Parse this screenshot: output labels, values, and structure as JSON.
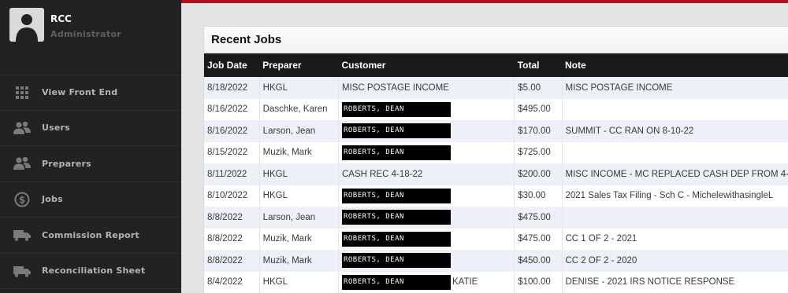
{
  "profile": {
    "name": "RCC",
    "role": "Administrator"
  },
  "sidebar": {
    "items": [
      {
        "label": "View Front End",
        "icon": "grid-icon"
      },
      {
        "label": "Users",
        "icon": "users-icon"
      },
      {
        "label": "Preparers",
        "icon": "users-icon"
      },
      {
        "label": "Jobs",
        "icon": "dollar-icon"
      },
      {
        "label": "Commission Report",
        "icon": "truck-icon"
      },
      {
        "label": "Reconciliation Sheet",
        "icon": "truck-icon"
      }
    ]
  },
  "colors": {
    "sidebar": "#222222",
    "accent": "#a8141e",
    "row_alt": "#eef0f8",
    "header": "#1a1a1a"
  },
  "panel": {
    "title": "Recent Jobs",
    "columns": [
      "Job Date",
      "Preparer",
      "Customer",
      "Total",
      "Note"
    ],
    "rows": [
      {
        "date": "8/18/2022",
        "preparer": "HKGL",
        "customer": "MISC POSTAGE INCOME",
        "redacted": false,
        "customer_suffix": "",
        "total": "$5.00",
        "note": "MISC POSTAGE INCOME"
      },
      {
        "date": "8/16/2022",
        "preparer": "Daschke, Karen",
        "customer": "ROBERTS, DEAN",
        "redacted": true,
        "customer_suffix": "",
        "total": "$495.00",
        "note": ""
      },
      {
        "date": "8/16/2022",
        "preparer": "Larson, Jean",
        "customer": "ROBERTS, DEAN",
        "redacted": true,
        "customer_suffix": "",
        "total": "$170.00",
        "note": "SUMMIT - CC RAN ON 8-10-22"
      },
      {
        "date": "8/15/2022",
        "preparer": "Muzik, Mark",
        "customer": "ROBERTS, DEAN",
        "redacted": true,
        "customer_suffix": "",
        "total": "$725.00",
        "note": ""
      },
      {
        "date": "8/11/2022",
        "preparer": "HKGL",
        "customer": "CASH REC 4-18-22",
        "redacted": false,
        "customer_suffix": "",
        "total": "$200.00",
        "note": "MISC INCOME - MC REPLACED CASH DEP FROM 4-"
      },
      {
        "date": "8/10/2022",
        "preparer": "HKGL",
        "customer": "ROBERTS, DEAN",
        "redacted": true,
        "customer_suffix": "",
        "total": "$30.00",
        "note": "2021 Sales Tax Filing - Sch C - MichelewithasingleL"
      },
      {
        "date": "8/8/2022",
        "preparer": "Larson, Jean",
        "customer": "ROBERTS, DEAN",
        "redacted": true,
        "customer_suffix": "",
        "total": "$475.00",
        "note": ""
      },
      {
        "date": "8/8/2022",
        "preparer": "Muzik, Mark",
        "customer": "ROBERTS, DEAN",
        "redacted": true,
        "customer_suffix": "",
        "total": "$475.00",
        "note": "CC 1 OF 2 - 2021"
      },
      {
        "date": "8/8/2022",
        "preparer": "Muzik, Mark",
        "customer": "ROBERTS, DEAN",
        "redacted": true,
        "customer_suffix": "",
        "total": "$450.00",
        "note": "CC 2 OF 2 - 2020"
      },
      {
        "date": "8/4/2022",
        "preparer": "HKGL",
        "customer": "ROBERTS, DEAN",
        "redacted": true,
        "customer_suffix": "KATIE",
        "total": "$100.00",
        "note": "DENISE - 2021 IRS NOTICE RESPONSE"
      }
    ]
  }
}
